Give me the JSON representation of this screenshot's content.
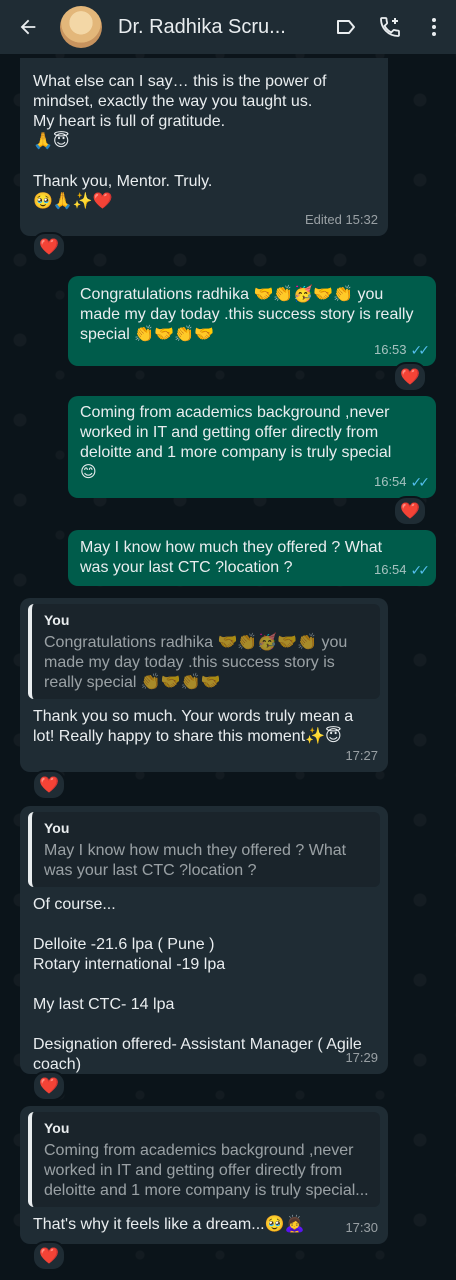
{
  "header": {
    "contact_name": "Dr. Radhika Scru...",
    "icons": [
      "back-arrow-icon",
      "label-icon",
      "add-call-icon",
      "more-vertical-icon"
    ]
  },
  "messages": [
    {
      "text": "What else can I say… this is the power of\nmindset, exactly the way you taught us.\nMy heart is full of gratitude.\n🙏😇\n\nThank you, Mentor. Truly.\n🥹🙏✨❤️",
      "time": "Edited 15:32",
      "reaction": "❤️"
    },
    {
      "text": "Congratulations radhika 🤝👏🥳🤝👏 you\nmade my day today .this success story is really\nspecial 👏🤝👏🤝",
      "time": "16:53",
      "reaction": "❤️"
    },
    {
      "text": "Coming from academics background ,never\nworked in IT and getting offer directly from\ndeloitte and 1 more company is truly special\n😊",
      "time": "16:54",
      "reaction": "❤️"
    },
    {
      "text": "May I know how much they offered ? What\nwas your last CTC ?location ?",
      "time": "16:54"
    },
    {
      "quote_author": "You",
      "quote_text": "Congratulations radhika 🤝👏🥳🤝👏 you\nmade my day today .this success story is\nreally special 👏🤝👏🤝",
      "text": "Thank you so much. Your words truly mean a\nlot! Really happy to share this moment✨😇",
      "time": "17:27",
      "reaction": "❤️"
    },
    {
      "quote_author": "You",
      "quote_text": "May I know how much they offered ? What\nwas your last CTC ?location ?",
      "text": "Of course...\n\nDelloite -21.6 lpa ( Pune )\nRotary international -19 lpa\n\nMy last CTC- 14 lpa\n\nDesignation offered- Assistant Manager ( Agile\ncoach)",
      "time": "17:29",
      "reaction": "❤️"
    },
    {
      "quote_author": "You",
      "quote_text": "Coming from academics background ,never\nworked in IT and getting offer directly from\ndeloitte and 1 more company is truly special...",
      "text": "That's why it feels like a dream...🥹🙇‍♀️",
      "time": "17:30",
      "reaction": "❤️"
    }
  ]
}
